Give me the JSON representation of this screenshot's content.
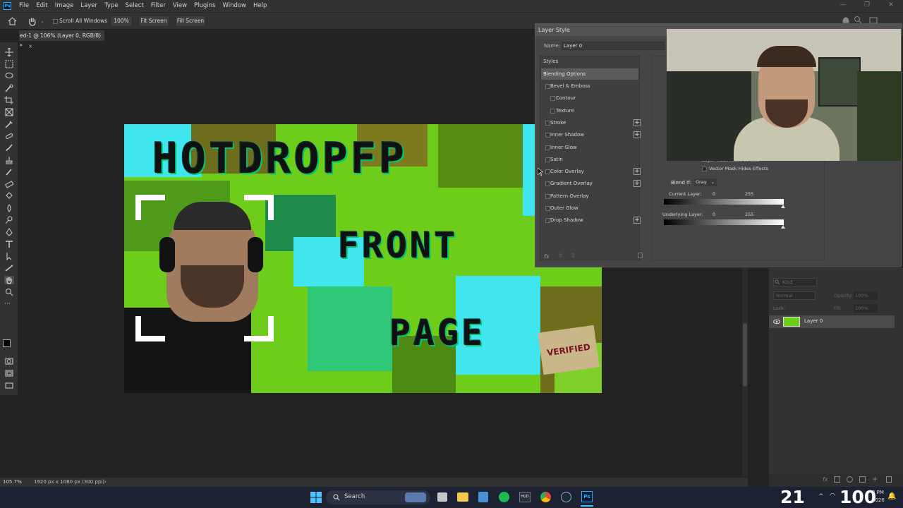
{
  "menubar": {
    "logo": "Ps",
    "items": [
      "File",
      "Edit",
      "Image",
      "Layer",
      "Type",
      "Select",
      "Filter",
      "View",
      "Plugins",
      "Window",
      "Help"
    ],
    "window_controls": [
      "—",
      "❐",
      "✕"
    ]
  },
  "options_bar": {
    "scroll_all_windows_label": "Scroll All Windows",
    "zoom_button": "100%",
    "fit_screen": "Fit Screen",
    "fill_screen": "Fill Screen"
  },
  "document_tab": {
    "title": "ed-1 @ 106% (Layer 0, RGB/8) *",
    "close": "×"
  },
  "canvas": {
    "title_line1": "HOTDROPFP",
    "title_line2": "FRONT",
    "title_line3": "PAGE",
    "sticker_text": "VERIFIED"
  },
  "status_bar": {
    "zoom": "105.7%",
    "doc_info": "1920 px x 1080 px (300 ppi)",
    "arrow": "›"
  },
  "layer_style_dialog": {
    "title": "Layer Style",
    "name_label": "Name:",
    "name_value": "Layer 0",
    "styles_header": "Styles",
    "blending_options": "Blending Options",
    "items": [
      {
        "label": "Bevel & Emboss",
        "indent": false,
        "plus": false
      },
      {
        "label": "Contour",
        "indent": true,
        "plus": false
      },
      {
        "label": "Texture",
        "indent": true,
        "plus": false
      },
      {
        "label": "Stroke",
        "indent": false,
        "plus": true
      },
      {
        "label": "Inner Shadow",
        "indent": false,
        "plus": true
      },
      {
        "label": "Inner Glow",
        "indent": false,
        "plus": false
      },
      {
        "label": "Satin",
        "indent": false,
        "plus": false
      },
      {
        "label": "Color Overlay",
        "indent": false,
        "plus": true
      },
      {
        "label": "Gradient Overlay",
        "indent": false,
        "plus": true
      },
      {
        "label": "Pattern Overlay",
        "indent": false,
        "plus": false
      },
      {
        "label": "Outer Glow",
        "indent": false,
        "plus": false
      },
      {
        "label": "Drop Shadow",
        "indent": false,
        "plus": true
      }
    ],
    "fx_label": "fx",
    "partial_label": "Layer Mask Hides Effects",
    "vector_mask_label": "Vector Mask Hides Effects",
    "blend_if_label": "Blend If:",
    "blend_if_value": "Gray",
    "current_layer_label": "Current Layer:",
    "current_layer_min": "0",
    "current_layer_max": "255",
    "underlying_layer_label": "Underlying Layer:",
    "underlying_layer_min": "0",
    "underlying_layer_max": "255"
  },
  "layers_panel": {
    "kind_placeholder": "Kind",
    "blend_mode": "Normal",
    "opacity_label": "Opacity:",
    "opacity_value": "100%",
    "lock_label": "Lock:",
    "fill_label": "Fill:",
    "fill_value": "100%",
    "layer_name": "Layer 0"
  },
  "taskbar": {
    "search_label": "Search",
    "clock_time": "2 PM",
    "clock_date": "2026",
    "overlay_left": "21",
    "overlay_right": "100"
  },
  "colors": {
    "neon_green": "#6ecd1a",
    "cyan": "#3fe6ee",
    "olive": "#6d6d1c",
    "dialog_bg": "#454545",
    "panel_bg": "#323232"
  }
}
